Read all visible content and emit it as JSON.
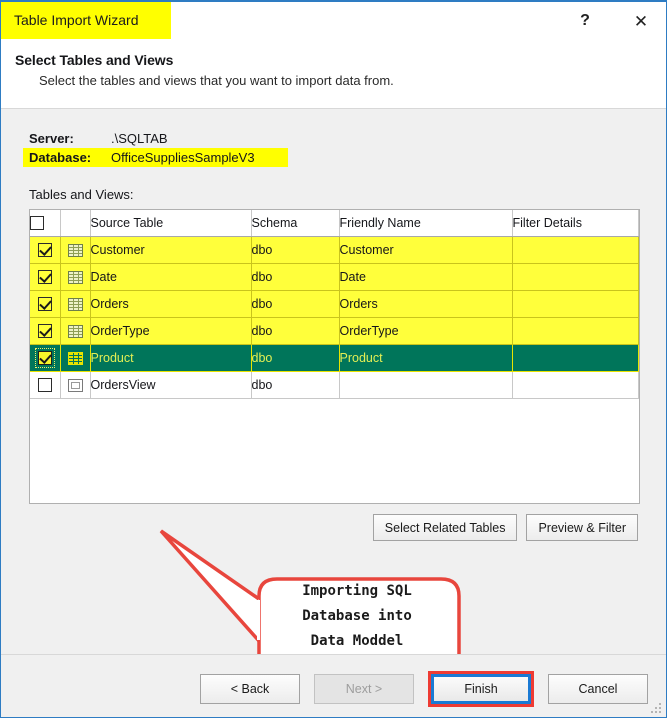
{
  "window": {
    "title": "Table Import Wizard",
    "help_icon": "question-mark-icon",
    "close_icon": "close-icon"
  },
  "header": {
    "title": "Select Tables and Views",
    "subtitle": "Select the tables and views that you want to import data from."
  },
  "connection": {
    "server_label": "Server:",
    "server_value": ".\\SQLTAB",
    "database_label": "Database:",
    "database_value": "OfficeSuppliesSampleV3",
    "list_label": "Tables and Views:"
  },
  "grid": {
    "columns": [
      "",
      "",
      "Source Table",
      "Schema",
      "Friendly Name",
      "Filter Details"
    ],
    "header_checkbox_checked": false,
    "rows": [
      {
        "checked": true,
        "icon": "table-icon",
        "source": "Customer",
        "schema": "dbo",
        "friendly": "Customer",
        "filter": "",
        "state": "yellow"
      },
      {
        "checked": true,
        "icon": "table-icon",
        "source": "Date",
        "schema": "dbo",
        "friendly": "Date",
        "filter": "",
        "state": "yellow"
      },
      {
        "checked": true,
        "icon": "table-icon",
        "source": "Orders",
        "schema": "dbo",
        "friendly": "Orders",
        "filter": "",
        "state": "yellow"
      },
      {
        "checked": true,
        "icon": "table-icon",
        "source": "OrderType",
        "schema": "dbo",
        "friendly": "OrderType",
        "filter": "",
        "state": "yellow"
      },
      {
        "checked": true,
        "icon": "table-icon",
        "source": "Product",
        "schema": "dbo",
        "friendly": "Product",
        "filter": "",
        "state": "selected"
      },
      {
        "checked": false,
        "icon": "view-icon",
        "source": "OrdersView",
        "schema": "dbo",
        "friendly": "",
        "filter": "",
        "state": "plain"
      }
    ]
  },
  "annotation": {
    "line1": "Importing SQL",
    "line2": "Database into",
    "line3": "Data Moddel",
    "color": "#ee3b33"
  },
  "actions": {
    "select_related": "Select Related Tables",
    "preview_filter": "Preview & Filter"
  },
  "navigation": {
    "back": "< Back",
    "next": "Next >",
    "next_disabled": true,
    "finish": "Finish",
    "cancel": "Cancel"
  },
  "colors": {
    "highlight_yellow": "#ffff00",
    "row_yellow": "#ffff3b",
    "selected_green": "#00755a",
    "selected_text": "#e3ef54",
    "focus_blue": "#1a7ad4",
    "callout_red": "#ee3b33",
    "window_border": "#2e7cc3"
  }
}
